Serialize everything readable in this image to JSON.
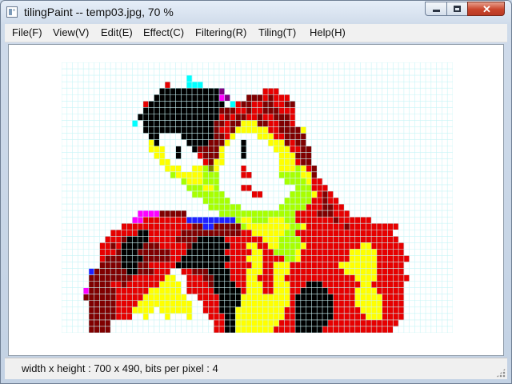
{
  "window": {
    "title": "tilingPaint -- temp03.jpg, 70 %",
    "controls": {
      "close_glyph": "✕"
    }
  },
  "menu": [
    {
      "label": "File(F)"
    },
    {
      "label": "View(V)"
    },
    {
      "label": "Edit(E)"
    },
    {
      "label": "Effect(C)"
    },
    {
      "label": "Filtering(R)"
    },
    {
      "label": "Tiling(T)"
    },
    {
      "label": "Help(H)"
    }
  ],
  "status": {
    "text": "width x height : 700 x 490, bits per pixel : 4"
  },
  "image": {
    "description_icon": "tiled-pixel-image",
    "grid_color": "#c8f4f6",
    "palette": {
      "w": "#ffffff",
      "k": "#000000",
      "d": "#800000",
      "r": "#e60000",
      "y": "#ffff00",
      "g": "#a8ff00",
      "o": "#808000",
      "m": "#ff00ff",
      "b": "#2020ff",
      "p": "#800080",
      "c": "#00ffff"
    },
    "rows": [
      "wwwwwwwwwwwwwwwwwwwwwwwwwwwwwwwwwwwwwwwwwwwwwwwwwwwwwwwwwwwwwwwwwwwwww",
      "wwwwwwwwwwwwwwwwwwwwwwwwwwwwwwwwwwwwwwwwwwwwwwwwwwwwwwwwwwwwwwwwwwwwww",
      "wwwwwwwwwwwwwwwwwwwwwwwcwwwwwwwwwwwwwwwwwwwwwwwwwwwwwwwwwwwwwwwwwwwwww",
      "wwwwwwwwwwwwwwwwwwwrwwwcccwwwwwwwwwwwwwwwwwwwwwwwwwwwwwwwwwwwwwwwwwwww",
      "wwwwwwwwwwwwwwwwwwkkkkkkkkkkkpwwwwwwwrrrwwwwwwwwwwwwwwwwwwwwwwwwwwwwww",
      "wwwwwwwwwwwwwwwwwkkkkkkkkkkkkmpwwwdddrdrrrwwwwwwwwwwwwwwwwwwwwwwwwwwww",
      "wwwwwwwwwwwwwwwrkkkkkkkkkkkkkkwcrddrrddrrddwwwwwwwwwwwwwwwwwwwwwwwwwww",
      "wwwwwwwwwwwwwwwkkkkkkkkkkkkkkdddrrdrrdddrrrwwwwwwwwwwwwwwwwwwwwwwwwwww",
      "wwwwwwwwwwwwwwkkkkkkkkkkkkkkkrdrddrrdrrdddrwwwwwwwwwwwwwwwwwwwwwwwwwww",
      "wwwwwwwwwwwwwcwkkkkkkkkkkkkkddrddyyyddrrddrwwwwwwwwwwwwwwwwwwwwwwwwwww",
      "wwwwwwwwwwwwwwwkkkkkkkkkkkkkdrrdyyyyyyrrddddywwwwwwwwwwwwwwwwwwwwwwwww",
      "wwwwwwwwwwwwwwwwkkwwwwkkkkkkddrywwwwyyyrrddddwwwwwwwwwwwwwwwwwwwwwwwww",
      "wwwwwwwwwwwwwwwwykwwwwwkkkkdddywwkwwwwyyydrddwwwwwwwwwwwwwwwwwwwwwwwww",
      "wwwwwwwwwwwwwwwwyyywwkwwkddddywwwkwwwwwyyyrrddwwwwwwwwwwwwwwwwwwwwwwww",
      "wwwwwwwwwwwwwwwwwyywwkwwwrdddywwwkwwwwwwyyydddwwwwwwwwwwwwwwwwwwwwwwww",
      "wwwwwwwwwwwwwwwwwwyywwwwwwrdyywwwwwwwwwwyyyrddwwwwwwwwwwwwwwwwwwwwwwww",
      "wwwwwwwwwwwwwwwwwwwyyywwyygoywwwwrwwwwwwyyygyrdwwwwwwwwwwwwwwwwwwwwwww",
      "wwwwwwwwwwwwwwwwwwwwgyyyyygggwwwwrrwwwwwggggyydwwwwwwwwwwwwwwwwwwwwwww",
      "wwwwwwwwwwwwwwwwwwwwwwgyyygggwwwwwwwwwwwwggggyrrwwwwwwwwwwwwwwwwwwwwww",
      "wwwwwwwwwwwwwwwwwwwwwwwgggyygwwwwrrwwwwwwwwgggrrrwwwwwwwwwwwwwwwwwwwww",
      "wwwwwwwwwwwwwwwwwwwwwwwwggggggwwwwwrrwwwwwggggyrdrwwwwwwwwwwwwwwwwwwww",
      "wwwwwwwwwwwwwwwwwwwwwwwwwwgggggwwwwwwwwwwgggggrrdrrwwwwwwwwwwwwwwwwwww",
      "wwwwwwwwwwwwwwwwwwwwwwwwwwwggggggwwwwwwwgggggrrrddrrwwwwwwwwwwwwwwwwww",
      "wwwwwwwwwwwwwwmmmmdddddwwwwwwggggggggggggggrrrrdddrrrwwwwwwwwwwwwwwwww",
      "wwwwwwwwwwwwwmmrrrrrrrrbbbbbbbbbgyygggyyyggrrrrrrrdrrrrrrwwwwwwwwwwwww",
      "wwwwwwwwwwwrrrrrrrrrrrrrddbbdddddgyyyyyyyyggyrrrrrrrdrrrrrrrrrwwwwwwwwww",
      "wwwwwwwwwrrrrrkkrrrrrrdddddddddddrryyyyyyggrrrrrrrrrrrrrrrrrrwwwwwwwwww",
      "wwwwwwwwrrrdkkkkrrrrrddddkkkkkrrrrrrryyyggggrrrrrrrrrrrrrrrrrrwwwwwwwww",
      "wwwwwwwrrdrkkkkdddrrrrrdkkkkkkkrrryyrryyggggyrrrrrrrrrryyrrrrrrwwwwwwwww",
      "wwwwwwwrrrdkkkddddddrrrkkkkkkkrrrrryyrrggggyrrrrrrrrryyyyyrrrrrwwwwwwwww",
      "wwwwwwwrdddkkkkdddddrrkkkkkkkkkrrryyyrrrrggyrrrrrrrrryyyyyrrrrrrwwwwwwww",
      "wwwwwwwddddkkkddrrrrrkkkkkkkkkrrrrryyrryyyrrrrrrrrryyyyyyyrrrrrwwwwwwww",
      "wwwwwbddddddkkdddrrrwwrrdddkkkkrrryyyrryyyrrrrrrrrrryyyyyyrrrrrwwwwwwww",
      "wwwwwddddddddrrrrrryywwrrrddkkkrrryyrrryyrrrrrrrrrrrrryyyyrrrrrrwwwwwww",
      "wwwwwddddrrdrrrrrryyyywrrrrdkkkkrryyyrryyyrrrkkkrrrrrrryyrrrrrrwwwwwww",
      "wwwwmdddddrrrrrryyyyyywrrrrrkkkkkryyyrryyyrrkkkkkrrrrryyyyrrrrrwwwwwww",
      "wwwwddddddrrrrryyyyyyyywwrrrrkkkkyyyyyyyyyrkkkkkkkrrrryyyyyrrrrwwwwwww",
      "wwwwwdddddrrrryyyyyyyyyywwrrrkkkkyyyyyyyyyrkkkkkkkrrrryyyyyrrrrwwwwwww",
      "wwwwwdddddrrryyyywyyyyyywwrrrkkkyyyyyyyyyrrkkkkkkkrrrrryyyyrrrrwwwwwww",
      "wwwwwdddddrrrwwywwwywwwywwwrrrkkyyyyyyyyyrrkkkkkkkrrrrrryyyrrrrwwwwwww",
      "wwwwwddddwwwwwwwwwwwwwwwwwwwrrkkyyyyyyyyrrrkkkkkkrrrrrrrrrrrrrwwwwwww",
      "wwwwwddddwwwwwwwwwwwwwwwwwwwrrkkyyyyyyyrrrrkkkkkrrrrrrrrrrrrrwwwwwwww"
    ]
  }
}
